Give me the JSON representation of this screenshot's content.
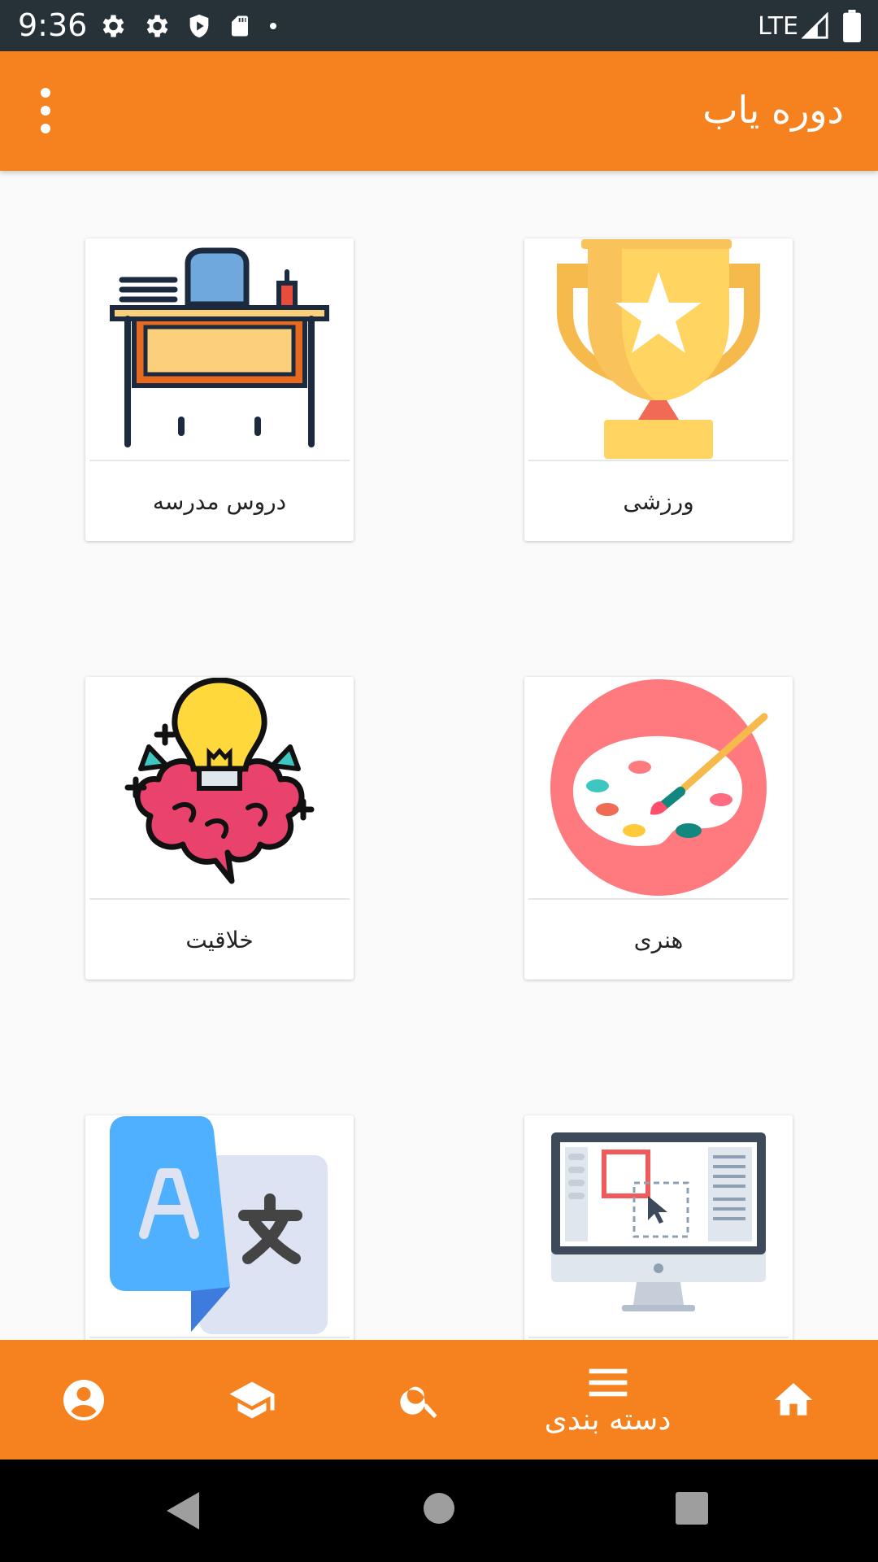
{
  "status_bar": {
    "time": "9:36",
    "network": "LTE",
    "icons": [
      "settings-icon",
      "settings-icon",
      "shield-play-icon",
      "sd-card-icon",
      "dot-icon",
      "signal-icon",
      "battery-icon"
    ]
  },
  "app_bar": {
    "title": "دوره یاب",
    "menu_icon": "more-vert-icon"
  },
  "categories": [
    {
      "label": "ورزشی",
      "icon": "trophy-icon"
    },
    {
      "label": "دروس مدرسه",
      "icon": "school-desk-icon"
    },
    {
      "label": "هنری",
      "icon": "paint-palette-icon"
    },
    {
      "label": "خلاقیت",
      "icon": "lightbulb-brain-icon"
    },
    {
      "label": "",
      "icon": "computer-design-icon"
    },
    {
      "label": "",
      "icon": "translate-icon"
    }
  ],
  "bottom_nav": {
    "items": [
      {
        "icon": "home-icon",
        "label": ""
      },
      {
        "icon": "menu-icon",
        "label": "دسته بندی"
      },
      {
        "icon": "search-icon",
        "label": ""
      },
      {
        "icon": "school-cap-icon",
        "label": ""
      },
      {
        "icon": "account-icon",
        "label": ""
      }
    ],
    "active_index": 1
  },
  "colors": {
    "primary": "#f5821f",
    "status_bar": "#263238",
    "background": "#fafafa"
  }
}
